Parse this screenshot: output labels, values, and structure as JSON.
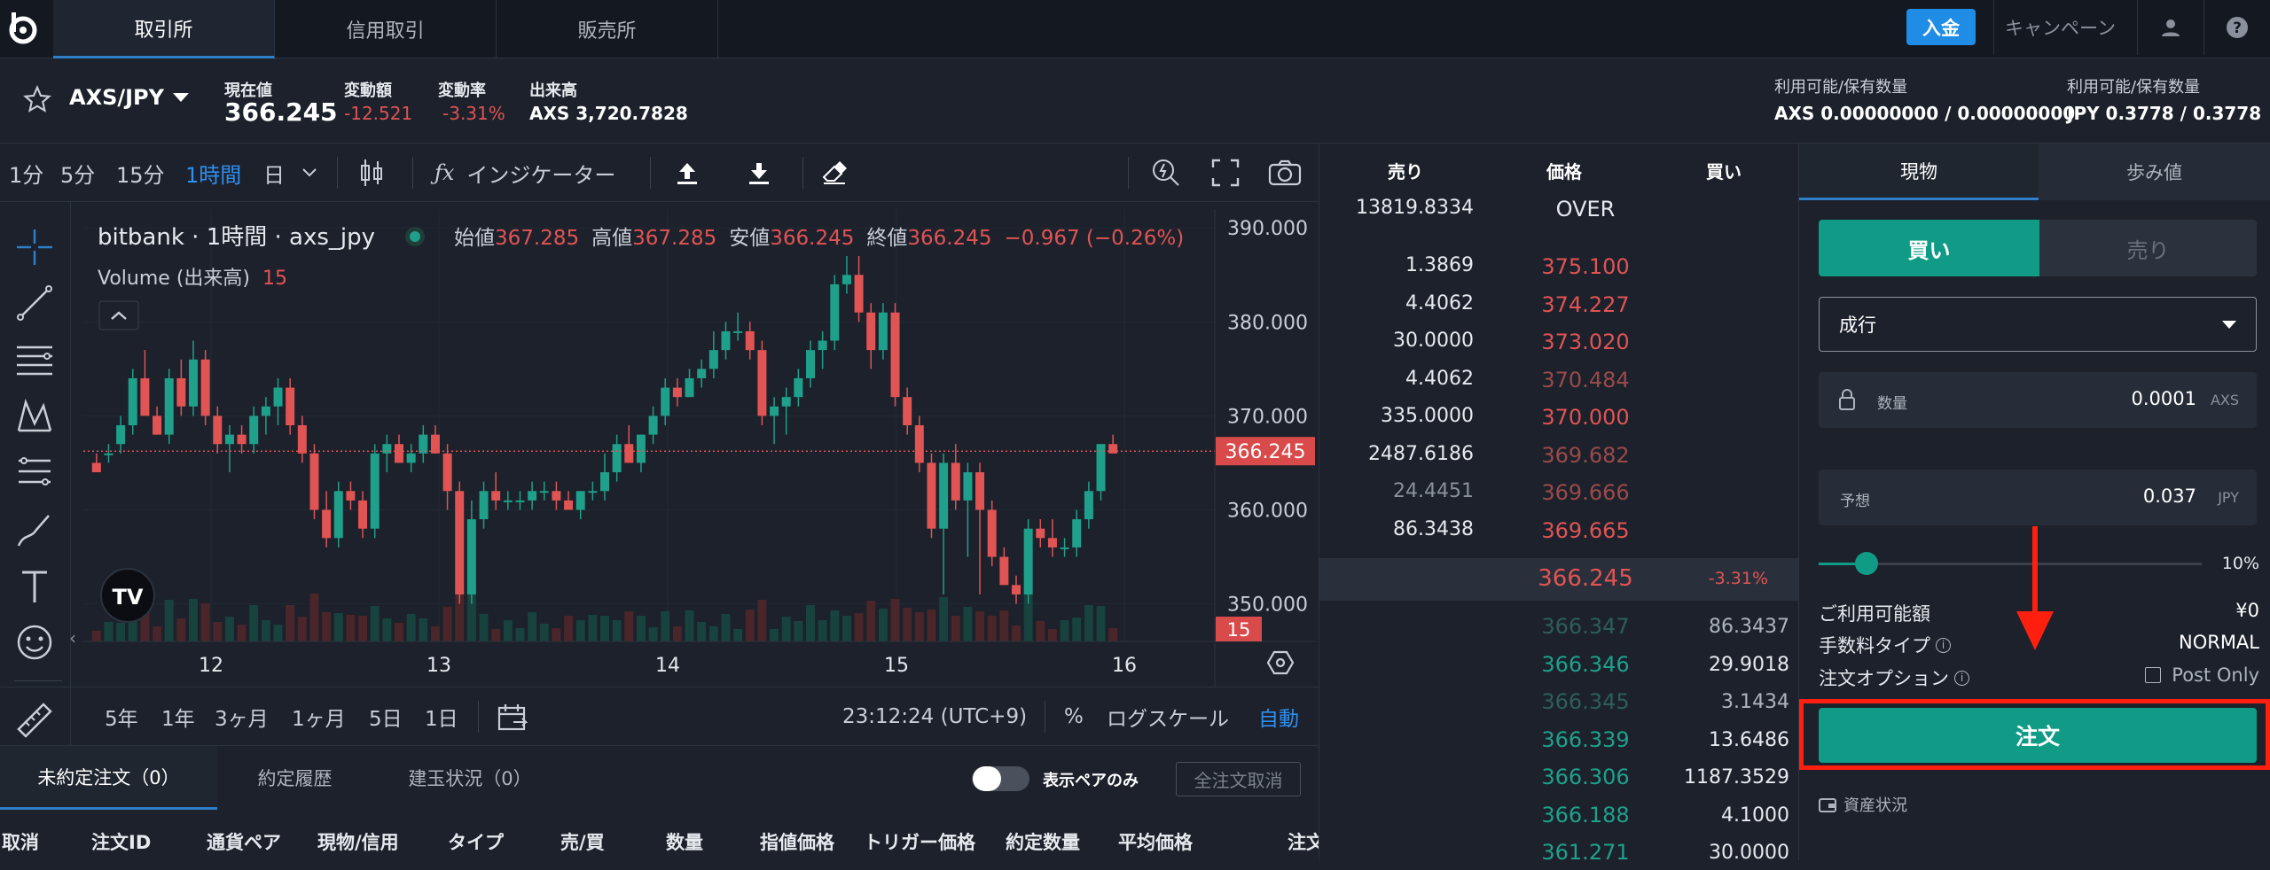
{
  "nav": {
    "tabs": [
      "取引所",
      "信用取引",
      "販売所"
    ],
    "deposit": "入金",
    "campaign": "キャンペーン"
  },
  "ticker": {
    "pair": "AXS/JPY",
    "price_label": "現在値",
    "price": "366.245",
    "change_label": "変動額",
    "change": "-12.521",
    "rate_label": "変動率",
    "rate": "-3.31%",
    "volume_label": "出来高",
    "volume": "AXS 3,720.7828",
    "avail1_label": "利用可能/保有数量",
    "avail1": "AXS 0.00000000 / 0.00000000",
    "avail2_label": "利用可能/保有数量",
    "avail2": "JPY 0.3778 / 0.3778"
  },
  "toolbar": {
    "intervals": [
      "1分",
      "5分",
      "15分",
      "1時間",
      "日"
    ],
    "indicator": "インジケーター"
  },
  "chart": {
    "title": "bitbank · 1時間 · axs_jpy",
    "open_label": "始値",
    "open": "367.285",
    "high_label": "高値",
    "high": "367.285",
    "low_label": "安値",
    "low": "366.245",
    "close_label": "終値",
    "close": "366.245",
    "chg": "−0.967 (−0.26%)",
    "volume_label": "Volume (出来高)",
    "volume_val": "15",
    "yticks": [
      "390.000",
      "380.000",
      "370.000",
      "360.000",
      "350.000"
    ],
    "last_price": "366.245",
    "last_vol": "15",
    "xticks": [
      "12",
      "13",
      "14",
      "15",
      "16"
    ]
  },
  "chart_data": {
    "type": "candlestick",
    "title": "bitbank · 1時間 · axs_jpy",
    "ylim": [
      346,
      392
    ],
    "x": [
      "12",
      "13",
      "14",
      "15",
      "16"
    ],
    "last": 366.245,
    "candles": [
      [
        365,
        366,
        364,
        364
      ],
      [
        366,
        367,
        365,
        366
      ],
      [
        367,
        370,
        366,
        369
      ],
      [
        369,
        375,
        368,
        374
      ],
      [
        374,
        377,
        372,
        370
      ],
      [
        370,
        371,
        368,
        368
      ],
      [
        368,
        375,
        367,
        374
      ],
      [
        374,
        376,
        370,
        371
      ],
      [
        371,
        378,
        370,
        376
      ],
      [
        376,
        377,
        369,
        370
      ],
      [
        370,
        371,
        366,
        367
      ],
      [
        367,
        369,
        364,
        368
      ],
      [
        368,
        369,
        366,
        367
      ],
      [
        367,
        371,
        366,
        370
      ],
      [
        370,
        372,
        368,
        371
      ],
      [
        371,
        374,
        369,
        373
      ],
      [
        373,
        374,
        368,
        369
      ],
      [
        369,
        370,
        365,
        366
      ],
      [
        366,
        367,
        359,
        360
      ],
      [
        360,
        362,
        356,
        357
      ],
      [
        357,
        363,
        356,
        362
      ],
      [
        362,
        363,
        360,
        361
      ],
      [
        361,
        362,
        357,
        358
      ],
      [
        358,
        367,
        357,
        366
      ],
      [
        366,
        368,
        364,
        367
      ],
      [
        367,
        368,
        365,
        365
      ],
      [
        365,
        367,
        364,
        366
      ],
      [
        366,
        369,
        365,
        368
      ],
      [
        368,
        369,
        366,
        366
      ],
      [
        366,
        367,
        360,
        362
      ],
      [
        362,
        363,
        350,
        351
      ],
      [
        351,
        361,
        350,
        359
      ],
      [
        359,
        363,
        358,
        362
      ],
      [
        362,
        364,
        360,
        361
      ],
      [
        361,
        362,
        360,
        361
      ],
      [
        361,
        362,
        360,
        361
      ],
      [
        361,
        363,
        360,
        362
      ],
      [
        362,
        363,
        361,
        362
      ],
      [
        362,
        363,
        360,
        361
      ],
      [
        361,
        362,
        360,
        360
      ],
      [
        360,
        362,
        359,
        362
      ],
      [
        362,
        363,
        361,
        362
      ],
      [
        362,
        366,
        361,
        364
      ],
      [
        364,
        368,
        363,
        367
      ],
      [
        367,
        369,
        365,
        365
      ],
      [
        365,
        368,
        364,
        368
      ],
      [
        368,
        371,
        367,
        370
      ],
      [
        370,
        374,
        369,
        373
      ],
      [
        373,
        374,
        371,
        372
      ],
      [
        372,
        375,
        372,
        374
      ],
      [
        374,
        376,
        373,
        375
      ],
      [
        375,
        379,
        374,
        377
      ],
      [
        377,
        380,
        376,
        379
      ],
      [
        379,
        381,
        378,
        379
      ],
      [
        379,
        380,
        376,
        377
      ],
      [
        377,
        378,
        369,
        370
      ],
      [
        370,
        372,
        367,
        371
      ],
      [
        371,
        373,
        368,
        372
      ],
      [
        372,
        375,
        371,
        374
      ],
      [
        374,
        378,
        373,
        377
      ],
      [
        377,
        379,
        375,
        378
      ],
      [
        378,
        385,
        377,
        384
      ],
      [
        384,
        387,
        383,
        385
      ],
      [
        385,
        387,
        380,
        381
      ],
      [
        381,
        382,
        375,
        377
      ],
      [
        377,
        382,
        376,
        381
      ],
      [
        381,
        382,
        371,
        372
      ],
      [
        372,
        373,
        368,
        369
      ],
      [
        369,
        370,
        364,
        365
      ],
      [
        365,
        366,
        357,
        358
      ],
      [
        358,
        366,
        351,
        365
      ],
      [
        365,
        367,
        360,
        361
      ],
      [
        361,
        365,
        355,
        364
      ],
      [
        364,
        365,
        351,
        360
      ],
      [
        360,
        361,
        354,
        355
      ],
      [
        355,
        356,
        352,
        352
      ],
      [
        352,
        353,
        350,
        351
      ],
      [
        351,
        359,
        350,
        358
      ],
      [
        358,
        359,
        356,
        357
      ],
      [
        357,
        359,
        355,
        356
      ],
      [
        356,
        357,
        355,
        356
      ],
      [
        356,
        360,
        355,
        359
      ],
      [
        359,
        363,
        358,
        362
      ],
      [
        362,
        367,
        361,
        367
      ],
      [
        367,
        368,
        366,
        366
      ]
    ],
    "volume_label": "Volume (出来高)",
    "last_volume": 15
  },
  "chartfoot": {
    "ranges": [
      "5年",
      "1年",
      "3ヶ月",
      "1ヶ月",
      "5日",
      "1日"
    ],
    "time": "23:12:24 (UTC+9)",
    "pct": "%",
    "log": "ログスケール",
    "auto": "自動"
  },
  "orders": {
    "tabs": [
      "未約定注文（0）",
      "約定履歴",
      "建玉状況（0）"
    ],
    "pair_only": "表示ペアのみ",
    "cancel_all": "全注文取消",
    "cols": [
      "取消",
      "注文ID",
      "通貨ペア",
      "現物/信用",
      "タイプ",
      "売/買",
      "数量",
      "指値価格",
      "トリガー価格",
      "約定数量",
      "平均価格",
      "注文"
    ]
  },
  "book": {
    "head_sell": "売り",
    "head_price": "価格",
    "head_buy": "買い",
    "over_qty": "13819.8334",
    "over": "OVER",
    "asks": [
      {
        "q": "1.3869",
        "p": "375.100"
      },
      {
        "q": "4.4062",
        "p": "374.227"
      },
      {
        "q": "30.0000",
        "p": "373.020"
      },
      {
        "q": "4.4062",
        "p": "370.484"
      },
      {
        "q": "335.0000",
        "p": "370.000"
      },
      {
        "q": "2487.6186",
        "p": "369.682"
      },
      {
        "q": "24.4451",
        "p": "369.666"
      },
      {
        "q": "86.3438",
        "p": "369.665"
      }
    ],
    "mid_price": "366.245",
    "mid_rate": "-3.31%",
    "bids": [
      {
        "p": "366.347",
        "q": "86.3437"
      },
      {
        "p": "366.346",
        "q": "29.9018"
      },
      {
        "p": "366.345",
        "q": "3.1434"
      },
      {
        "p": "366.339",
        "q": "13.6486"
      },
      {
        "p": "366.306",
        "q": "1187.3529"
      },
      {
        "p": "366.188",
        "q": "4.1000"
      },
      {
        "p": "361.271",
        "q": "30.0000"
      }
    ]
  },
  "panel": {
    "tab_spot": "現物",
    "tab_trades": "歩み値",
    "buy": "買い",
    "sell": "売り",
    "order_type": "成行",
    "qty_label": "数量",
    "qty": "0.0001",
    "qty_unit": "AXS",
    "est_label": "予想",
    "est": "0.037",
    "est_unit": "JPY",
    "slider_pct": 0.1,
    "slider_label": "10%",
    "avail_label": "ご利用可能額",
    "avail": "¥0",
    "fee_label": "手数料タイプ",
    "fee": "NORMAL",
    "opt_label": "注文オプション",
    "post_only": "Post Only",
    "submit": "注文",
    "assets": "資産状況"
  },
  "colors": {
    "accent": "#0f9b85",
    "red": "#e05454",
    "highlight": "#ff1f0f",
    "link": "#2f7ec7"
  }
}
